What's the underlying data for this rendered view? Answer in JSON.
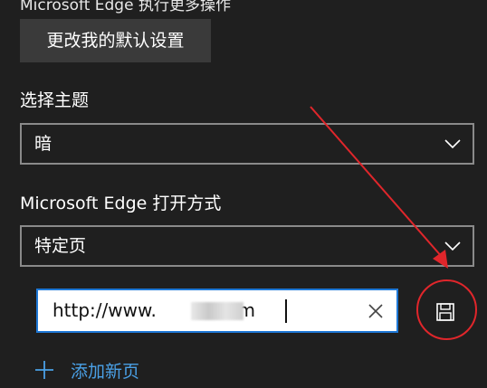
{
  "section_heading_cut": "Microsoft Edge 执行更多操作",
  "default_button_label": "更改我的默认设置",
  "theme": {
    "label": "选择主题",
    "selected": "暗"
  },
  "open_with": {
    "label": "Microsoft Edge 打开方式",
    "selected": "特定页"
  },
  "url_input": {
    "value_prefix": "http://www.",
    "value_suffix": ".com"
  },
  "add_page_label": "添加新页",
  "icons": {
    "clear": "close-icon",
    "save": "floppy-save-icon",
    "add": "plus-icon",
    "dropdown": "chevron-down-icon"
  },
  "colors": {
    "background": "#1f1f1f",
    "button": "#3a3a3a",
    "accent": "#1e78d6",
    "link": "#4aa0e6",
    "annotation": "#e0262b"
  }
}
